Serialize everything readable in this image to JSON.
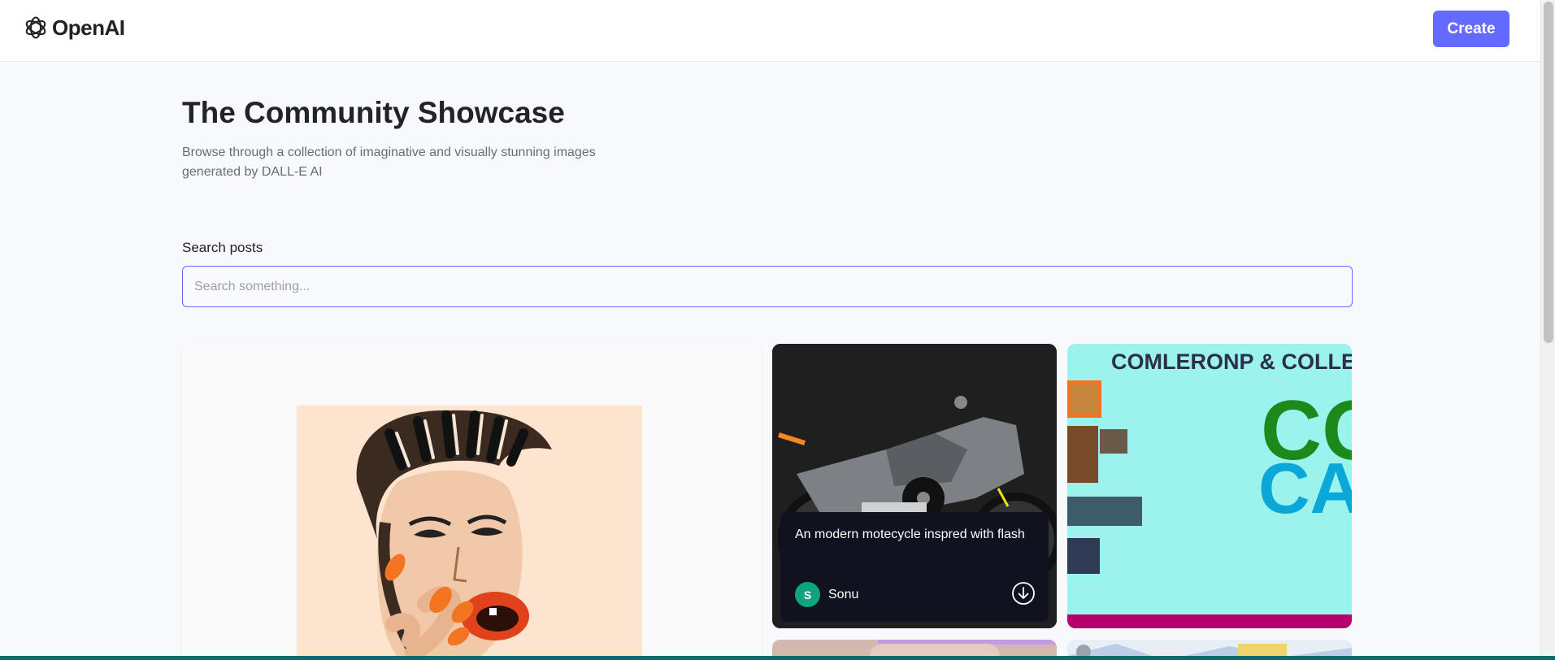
{
  "header": {
    "logo_text": "OpenAI",
    "create_label": "Create"
  },
  "hero": {
    "title": "The Community Showcase",
    "subtitle": "Browse through a collection of imaginative and visually stunning images generated by DALL-E AI"
  },
  "search": {
    "label": "Search posts",
    "placeholder": "Search something..."
  },
  "cards": [
    {
      "image": "pop-art-portrait"
    },
    {
      "image": "motorcycle",
      "prompt": "An modern motecycle inspred with flash",
      "author": "Sonu",
      "author_initial": "S"
    },
    {
      "image": "collage",
      "text_top": "COMLERONP & COLLE",
      "text_big_1": "CO",
      "text_big_2": "CAC"
    }
  ],
  "colors": {
    "accent": "#6469ff",
    "avatar": "#10a37f",
    "overlay": "#10131f"
  }
}
